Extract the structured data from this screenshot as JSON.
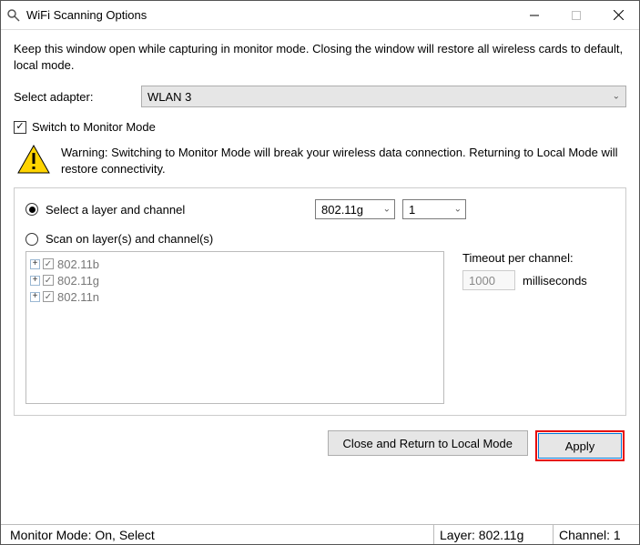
{
  "window": {
    "title": "WiFi Scanning Options"
  },
  "help": "Keep this window open while capturing in monitor mode. Closing the window will restore all wireless cards to default, local mode.",
  "adapter": {
    "label": "Select adapter:",
    "value": "WLAN 3"
  },
  "monitorCheckbox": {
    "label": "Switch to Monitor Mode",
    "checked": true
  },
  "warning": "Warning: Switching to Monitor Mode will break your wireless data connection. Returning to Local Mode will restore connectivity.",
  "panel": {
    "radioSelect": {
      "label": "Select a layer and channel",
      "selected": true,
      "layer": "802.11g",
      "channel": "1"
    },
    "radioScan": {
      "label": "Scan on layer(s) and channel(s)",
      "selected": false
    },
    "tree": {
      "items": [
        {
          "label": "802.11b"
        },
        {
          "label": "802.11g"
        },
        {
          "label": "802.11n"
        }
      ]
    },
    "timeout": {
      "label": "Timeout per channel:",
      "value": "1000",
      "unit": "milliseconds"
    }
  },
  "buttons": {
    "close": "Close and Return to Local Mode",
    "apply": "Apply"
  },
  "status": {
    "mode": "Monitor Mode: On, Select",
    "layer": "Layer: 802.11g",
    "channel": "Channel: 1"
  }
}
